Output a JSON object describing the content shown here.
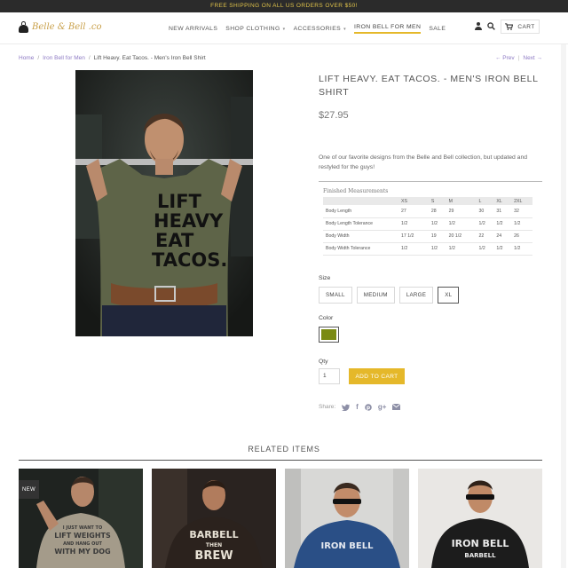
{
  "promo": "FREE SHIPPING ON ALL US ORDERS OVER $50!",
  "brand": {
    "logo_text": "Belle & Bell .co"
  },
  "nav": {
    "items": [
      {
        "label": "NEW ARRIVALS",
        "dropdown": false,
        "active": false
      },
      {
        "label": "SHOP CLOTHING",
        "dropdown": true,
        "active": false
      },
      {
        "label": "ACCESSORIES",
        "dropdown": true,
        "active": false
      },
      {
        "label": "IRON BELL FOR MEN",
        "dropdown": false,
        "active": true
      },
      {
        "label": "SALE",
        "dropdown": false,
        "active": false
      }
    ],
    "caret": "▾"
  },
  "header": {
    "cart_label": "CART"
  },
  "breadcrumb": {
    "home": "Home",
    "collection": "Iron Bell for Men",
    "current": "Lift Heavy. Eat Tacos. - Men's Iron Bell Shirt",
    "sep": "/"
  },
  "pager": {
    "prev": "← Prev",
    "next": "Next →",
    "sep": "|"
  },
  "product": {
    "title": "LIFT HEAVY. EAT TACOS. - MEN'S IRON BELL SHIRT",
    "price": "$27.95",
    "description": "One of our favorite designs from the Belle and Bell collection, but updated and restyled for the guys!",
    "shirt_print": [
      "LIFT",
      "HEAVY",
      "EAT",
      "TACOS."
    ],
    "measurements": {
      "title": "Finished Measurements",
      "headers": [
        "",
        "XS",
        "S",
        "M",
        "L",
        "XL",
        "2XL"
      ],
      "rows": [
        [
          "Body Length",
          "27",
          "28",
          "29",
          "30",
          "31",
          "32"
        ],
        [
          "Body Length Tolerance",
          "1/2",
          "1/2",
          "1/2",
          "1/2",
          "1/2",
          "1/2"
        ],
        [
          "Body Width",
          "17 1/2",
          "19",
          "20 1/2",
          "22",
          "24",
          "26"
        ],
        [
          "Body Width Tolerance",
          "1/2",
          "1/2",
          "1/2",
          "1/2",
          "1/2",
          "1/2"
        ]
      ]
    },
    "size_label": "Size",
    "sizes": [
      "SMALL",
      "MEDIUM",
      "LARGE",
      "XL"
    ],
    "selected_size": "XL",
    "color_label": "Color",
    "color_swatch": "#7a8a12",
    "qty_label": "Qty",
    "qty_value": "1",
    "add_to_cart": "ADD TO CART",
    "share_label": "Share:",
    "share_icons": [
      "twitter-icon",
      "facebook-icon",
      "pinterest-icon",
      "google-plus-icon",
      "email-icon"
    ]
  },
  "related": {
    "title": "RELATED ITEMS",
    "badge": "NEW",
    "items": [
      {
        "print": [
          "I JUST WANT TO",
          "LIFT WEIGHTS",
          "AND HANG OUT",
          "WITH MY DOG"
        ],
        "shirt": "#a49b8a"
      },
      {
        "print": [
          "BARBELL",
          "THEN",
          "BREW"
        ],
        "shirt": "#2b221d"
      },
      {
        "print": [
          "IRON BELL"
        ],
        "shirt": "#2a4f86"
      },
      {
        "print": [
          "IRON BELL",
          "BARBELL"
        ],
        "shirt": "#1c1c1c"
      }
    ]
  },
  "colors": {
    "accent": "#e5b82a",
    "link": "#8e7bc4",
    "promo_bg": "#2b2b2b"
  }
}
